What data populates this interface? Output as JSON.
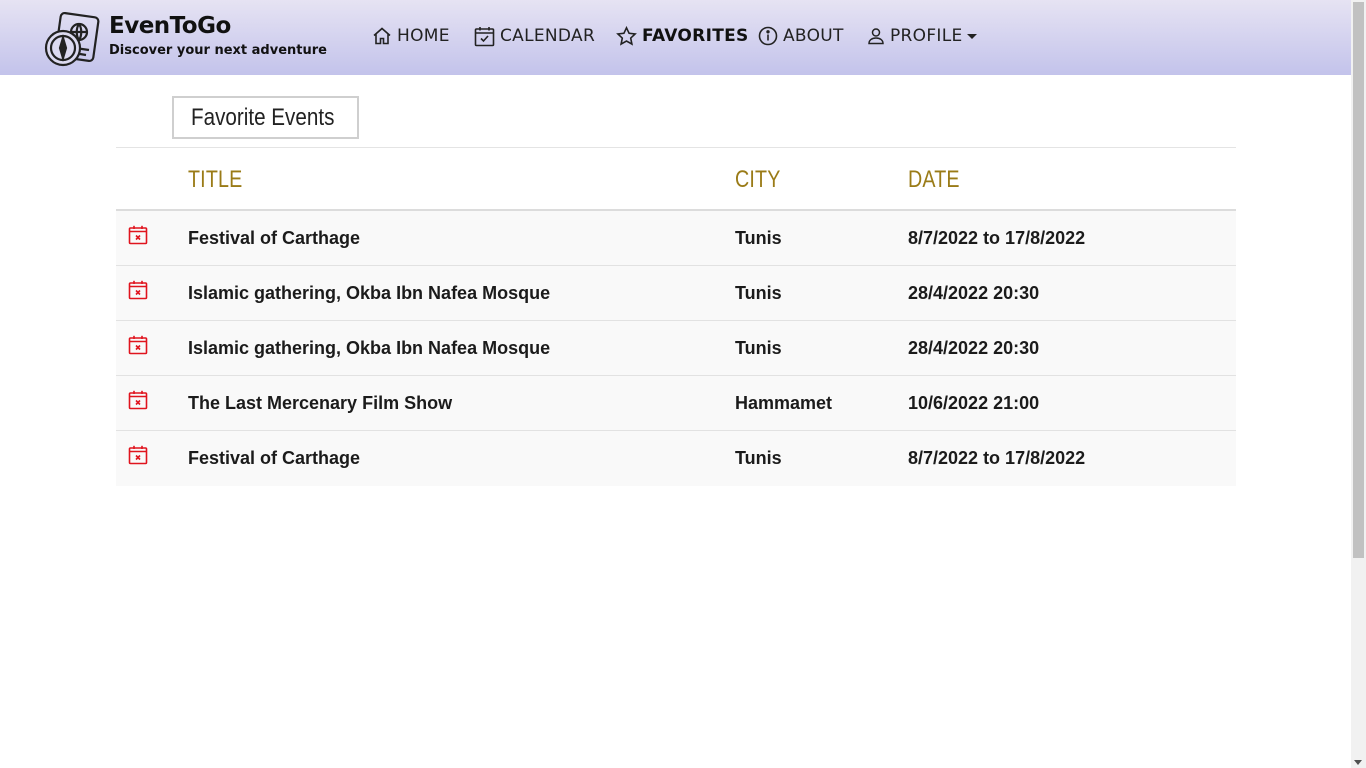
{
  "brand": {
    "title": "EvenToGo",
    "tagline": "Discover your next adventure",
    "logo_icon": "passport-compass-icon"
  },
  "nav": {
    "items": [
      {
        "label": "HOME",
        "icon": "home-icon",
        "active": false
      },
      {
        "label": "CALENDAR",
        "icon": "calendar-check-icon",
        "active": false
      },
      {
        "label": "FAVORITES",
        "icon": "star-icon",
        "active": true
      },
      {
        "label": "ABOUT",
        "icon": "info-circle-icon",
        "active": false
      },
      {
        "label": "PROFILE",
        "icon": "person-icon",
        "active": false,
        "dropdown": true
      }
    ]
  },
  "section": {
    "title": "Favorite Events",
    "icon": "calendar-heart-icon"
  },
  "table": {
    "headers": {
      "title": "TITLE",
      "city": "CITY",
      "date": "DATE"
    },
    "rows": [
      {
        "title": "Festival of Carthage",
        "city": "Tunis",
        "date": "8/7/2022 to 17/8/2022"
      },
      {
        "title": "Islamic gathering, Okba Ibn Nafea Mosque",
        "city": "Tunis",
        "date": "28/4/2022 20:30"
      },
      {
        "title": "Islamic gathering, Okba Ibn Nafea Mosque",
        "city": "Tunis",
        "date": "28/4/2022 20:30"
      },
      {
        "title": "The Last Mercenary Film Show",
        "city": "Hammamet",
        "date": "10/6/2022 21:00"
      },
      {
        "title": "Festival of Carthage",
        "city": "Tunis",
        "date": "8/7/2022 to 17/8/2022"
      }
    ],
    "remove_icon": "calendar-x-icon"
  },
  "colors": {
    "header_gradient_top": "#e6e3f3",
    "header_gradient_bottom": "#c3c3eb",
    "column_header": "#9a7b17",
    "remove_icon": "#e0141e",
    "row_background": "#f9f9f9"
  }
}
